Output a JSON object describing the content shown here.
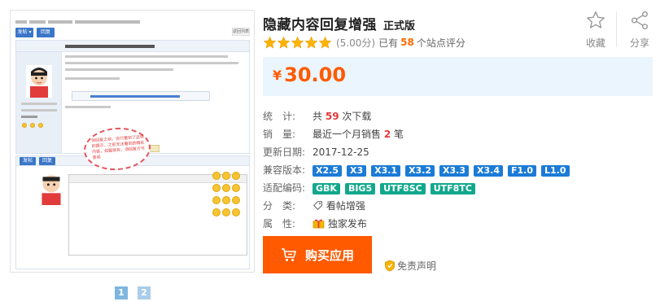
{
  "product": {
    "title": "隐藏内容回复增强",
    "edition": "正式版"
  },
  "actions": {
    "favorite_label": "收藏",
    "share_label": "分享"
  },
  "rating": {
    "stars": 5,
    "score": "(5.00分)",
    "prefix": "已有",
    "count": "58",
    "suffix": "个站点评分"
  },
  "price": {
    "currency": "¥",
    "value": "30.00"
  },
  "details": {
    "stats_label": "统　计:",
    "stats_prefix": "共",
    "stats_count": "59",
    "stats_suffix": "次下载",
    "sales_label": "销　量:",
    "sales_prefix": "最近一个月销售",
    "sales_count": "2",
    "sales_suffix": "笔",
    "updated_label": "更新日期:",
    "updated_value": "2017-12-25",
    "compat_label": "兼容版本:",
    "compat_versions": [
      "X2.5",
      "X3",
      "X3.1",
      "X3.2",
      "X3.3",
      "X3.4",
      "F1.0",
      "L1.0"
    ],
    "encoding_label": "适配编码:",
    "encodings": [
      "GBK",
      "BIG5",
      "UTF8SC",
      "UTF8TC"
    ],
    "category_label": "分　类:",
    "category_value": "看帖增强",
    "attribute_label": "属　性:",
    "attribute_value": "独家发布"
  },
  "buy_label": "购买应用",
  "disclaimer_label": "免责声明",
  "pagination": [
    "1",
    "2"
  ],
  "preview": {
    "bubble_text": "你回复之前，你只看到了这样的提示，之前无法看到的精彩内容，如要就有，须回复方可查阅"
  },
  "colors": {
    "accent": "#ff5a00",
    "price_bg": "#ebf5fd",
    "tag_blue": "#1b7bd6",
    "tag_green": "#12a88c",
    "highlight_red": "#e4393c"
  }
}
